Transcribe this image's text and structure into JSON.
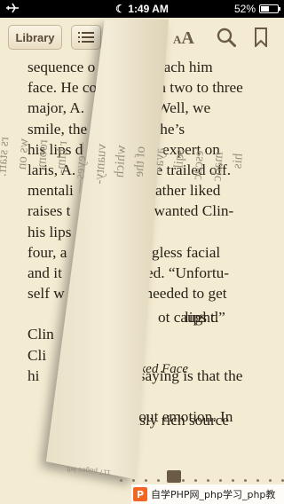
{
  "status": {
    "time": "1:49 AM",
    "battery": "52%",
    "battery_level": 0.52
  },
  "toolbar": {
    "library_label": "Library",
    "font_small": "A",
    "font_big": "A"
  },
  "page": {
    "lines": [
      "sequence o               teach him",
      "face. He co              on two to three",
      "major, A.                 “Well, we",
      "smile, the                d he’s",
      "his lips d                an expert on",
      "laris, A.                  ice trailed off.",
      "mentali                    rather liked",
      "raises t                   e wanted Clin-",
      "his lips                    ",
      "four, a                   ingless facial",
      "and it                    ged. “Unfortu-",
      "self w                     needed to get",
      "",
      "Clin",
      "Cli",
      "hi                          saying is that the",
      "",
      "                           bout emotion. In"
    ],
    "line_overlays": [
      {
        "text": "Clin-",
        "row": 8
      }
    ]
  },
  "curl_text": [
    "his",
    "matic",
    "escuc",
    "sqil",
    "aya-",
    "of the",
    "which",
    "vuanty-",
    "—eyes—",
    "r him-",
    "room.",
    "ws on",
    "rs staff.",
    "‘Look,’",
    "rolling",
    "thin ex-",
    "eyes is",
    "hink it’s"
  ],
  "page_extra": [
    "his lips                        ",
    "lips d",
    "ot caught.”",
    "aked Face",
    "ously rich source"
  ],
  "footer": {
    "pages_left": "117 pages left"
  },
  "watermark": {
    "logo": "P",
    "text": "自学PHP网_php学习_php教"
  }
}
